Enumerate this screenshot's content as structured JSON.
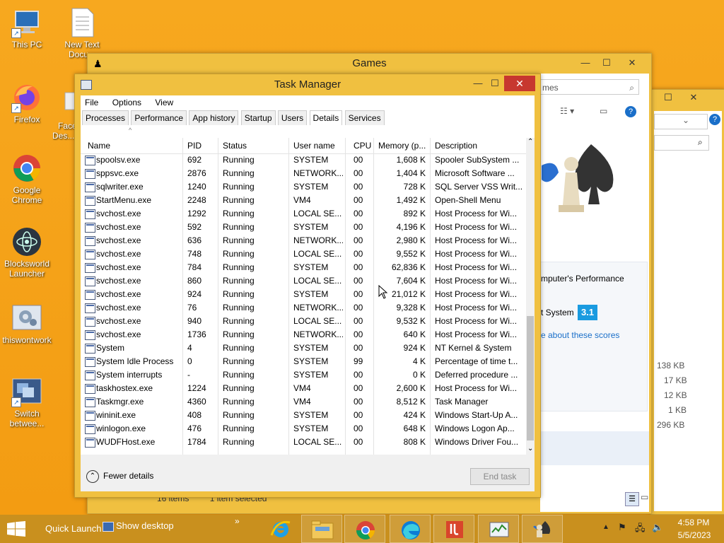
{
  "desktop_icons": [
    {
      "name": "this-pc",
      "label": "This PC"
    },
    {
      "name": "new-text-document",
      "label": "New Text Docu..."
    },
    {
      "name": "firefox",
      "label": "Firefox"
    },
    {
      "name": "faces-desk",
      "label": "Face Des..."
    },
    {
      "name": "google-chrome",
      "label": "Google Chrome"
    },
    {
      "name": "blocksworld-launcher",
      "label": "Blocksworld Launcher"
    },
    {
      "name": "thiswontwork",
      "label": "thiswontwork"
    },
    {
      "name": "switch-between",
      "label": "Switch betwee..."
    }
  ],
  "games_window": {
    "title": "Games",
    "search_placeholder": "mes",
    "performance_text": "mputer's Performance",
    "system_text": "t System",
    "score": "3.1",
    "scores_link": "e about these scores",
    "status_items": "16 items",
    "status_selected": "1 item selected"
  },
  "back_window": {
    "sizes": [
      "138 KB",
      "17 KB",
      "12 KB",
      "1 KB",
      "296 KB"
    ]
  },
  "task_manager": {
    "title": "Task Manager",
    "menu": [
      "File",
      "Options",
      "View"
    ],
    "tabs": [
      "Processes",
      "Performance",
      "App history",
      "Startup",
      "Users",
      "Details",
      "Services"
    ],
    "active_tab": "Details",
    "columns": [
      "Name",
      "PID",
      "Status",
      "User name",
      "CPU",
      "Memory (p...",
      "Description"
    ],
    "rows": [
      {
        "name": "spoolsv.exe",
        "pid": "692",
        "status": "Running",
        "user": "SYSTEM",
        "cpu": "00",
        "mem": "1,608 K",
        "desc": "Spooler SubSystem ..."
      },
      {
        "name": "sppsvc.exe",
        "pid": "2876",
        "status": "Running",
        "user": "NETWORK...",
        "cpu": "00",
        "mem": "1,404 K",
        "desc": "Microsoft Software ..."
      },
      {
        "name": "sqlwriter.exe",
        "pid": "1240",
        "status": "Running",
        "user": "SYSTEM",
        "cpu": "00",
        "mem": "728 K",
        "desc": "SQL Server VSS Writ..."
      },
      {
        "name": "StartMenu.exe",
        "pid": "2248",
        "status": "Running",
        "user": "VM4",
        "cpu": "00",
        "mem": "1,492 K",
        "desc": "Open-Shell Menu"
      },
      {
        "name": "svchost.exe",
        "pid": "1292",
        "status": "Running",
        "user": "LOCAL SE...",
        "cpu": "00",
        "mem": "892 K",
        "desc": "Host Process for Wi..."
      },
      {
        "name": "svchost.exe",
        "pid": "592",
        "status": "Running",
        "user": "SYSTEM",
        "cpu": "00",
        "mem": "4,196 K",
        "desc": "Host Process for Wi..."
      },
      {
        "name": "svchost.exe",
        "pid": "636",
        "status": "Running",
        "user": "NETWORK...",
        "cpu": "00",
        "mem": "2,980 K",
        "desc": "Host Process for Wi..."
      },
      {
        "name": "svchost.exe",
        "pid": "748",
        "status": "Running",
        "user": "LOCAL SE...",
        "cpu": "00",
        "mem": "9,552 K",
        "desc": "Host Process for Wi..."
      },
      {
        "name": "svchost.exe",
        "pid": "784",
        "status": "Running",
        "user": "SYSTEM",
        "cpu": "00",
        "mem": "62,836 K",
        "desc": "Host Process for Wi..."
      },
      {
        "name": "svchost.exe",
        "pid": "860",
        "status": "Running",
        "user": "LOCAL SE...",
        "cpu": "00",
        "mem": "7,604 K",
        "desc": "Host Process for Wi..."
      },
      {
        "name": "svchost.exe",
        "pid": "924",
        "status": "Running",
        "user": "SYSTEM",
        "cpu": "00",
        "mem": "21,012 K",
        "desc": "Host Process for Wi..."
      },
      {
        "name": "svchost.exe",
        "pid": "76",
        "status": "Running",
        "user": "NETWORK...",
        "cpu": "00",
        "mem": "9,328 K",
        "desc": "Host Process for Wi..."
      },
      {
        "name": "svchost.exe",
        "pid": "940",
        "status": "Running",
        "user": "LOCAL SE...",
        "cpu": "00",
        "mem": "9,532 K",
        "desc": "Host Process for Wi..."
      },
      {
        "name": "svchost.exe",
        "pid": "1736",
        "status": "Running",
        "user": "NETWORK...",
        "cpu": "00",
        "mem": "640 K",
        "desc": "Host Process for Wi..."
      },
      {
        "name": "System",
        "pid": "4",
        "status": "Running",
        "user": "SYSTEM",
        "cpu": "00",
        "mem": "924 K",
        "desc": "NT Kernel & System"
      },
      {
        "name": "System Idle Process",
        "pid": "0",
        "status": "Running",
        "user": "SYSTEM",
        "cpu": "99",
        "mem": "4 K",
        "desc": "Percentage of time t..."
      },
      {
        "name": "System interrupts",
        "pid": "-",
        "status": "Running",
        "user": "SYSTEM",
        "cpu": "00",
        "mem": "0 K",
        "desc": "Deferred procedure ..."
      },
      {
        "name": "taskhostex.exe",
        "pid": "1224",
        "status": "Running",
        "user": "VM4",
        "cpu": "00",
        "mem": "2,600 K",
        "desc": "Host Process for Wi..."
      },
      {
        "name": "Taskmgr.exe",
        "pid": "4360",
        "status": "Running",
        "user": "VM4",
        "cpu": "00",
        "mem": "8,512 K",
        "desc": "Task Manager"
      },
      {
        "name": "wininit.exe",
        "pid": "408",
        "status": "Running",
        "user": "SYSTEM",
        "cpu": "00",
        "mem": "424 K",
        "desc": "Windows Start-Up A..."
      },
      {
        "name": "winlogon.exe",
        "pid": "476",
        "status": "Running",
        "user": "SYSTEM",
        "cpu": "00",
        "mem": "648 K",
        "desc": "Windows Logon Ap..."
      },
      {
        "name": "WUDFHost.exe",
        "pid": "1784",
        "status": "Running",
        "user": "LOCAL SE...",
        "cpu": "00",
        "mem": "808 K",
        "desc": "Windows Driver Fou..."
      }
    ],
    "fewer_details": "Fewer details",
    "end_task": "End task"
  },
  "taskbar": {
    "quick_launch": "Quick Launch",
    "show_desktop": "Show desktop",
    "time": "4:58 PM",
    "date": "5/5/2023"
  },
  "colors": {
    "desktop": "#f5a623",
    "window_frame": "#f0c040",
    "close_red": "#c7372f",
    "taskbar": "#c9901e",
    "score_badge": "#1a9be0"
  }
}
